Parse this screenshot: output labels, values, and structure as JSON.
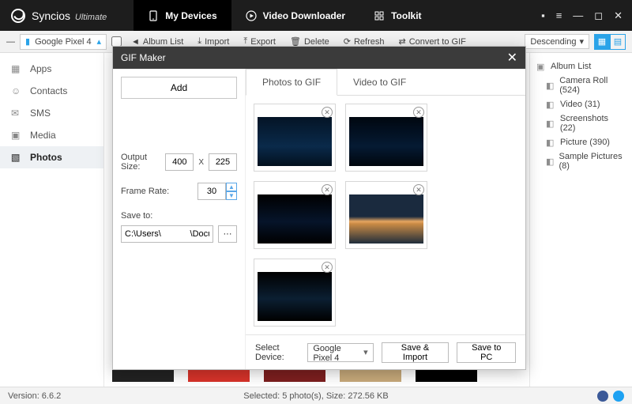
{
  "brand": {
    "name": "Syncios",
    "edition": "Ultimate"
  },
  "topTabs": [
    {
      "label": "My Devices"
    },
    {
      "label": "Video Downloader"
    },
    {
      "label": "Toolkit"
    }
  ],
  "toolbar": {
    "device": "Google Pixel 4",
    "buttons": {
      "albumList": "Album List",
      "import": "Import",
      "export": "Export",
      "delete": "Delete",
      "refresh": "Refresh",
      "convertGif": "Convert to GIF"
    },
    "sort": "Descending"
  },
  "leftnav": [
    {
      "label": "Apps"
    },
    {
      "label": "Contacts"
    },
    {
      "label": "SMS"
    },
    {
      "label": "Media"
    },
    {
      "label": "Photos"
    }
  ],
  "rightnav": {
    "root": "Album List",
    "items": [
      {
        "label": "Camera Roll (524)"
      },
      {
        "label": "Video (31)"
      },
      {
        "label": "Screenshots (22)"
      },
      {
        "label": "Picture (390)"
      },
      {
        "label": "Sample Pictures (8)"
      }
    ]
  },
  "dialog": {
    "title": "GIF Maker",
    "add": "Add",
    "outputSizeLabel": "Output Size:",
    "width": "400",
    "height": "225",
    "frameRateLabel": "Frame Rate:",
    "frameRate": "30",
    "saveToLabel": "Save to:",
    "savePath": "C:\\Users\\            \\Documen",
    "subtabs": {
      "photos": "Photos to GIF",
      "video": "Video to GIF"
    },
    "footer": {
      "selectDeviceLabel": "Select Device:",
      "selectedDevice": "Google Pixel 4",
      "saveImport": "Save & Import",
      "savePc": "Save to PC"
    }
  },
  "status": {
    "version": "Version: 6.6.2",
    "selection": "Selected: 5 photo(s), Size: 272.56 KB"
  }
}
